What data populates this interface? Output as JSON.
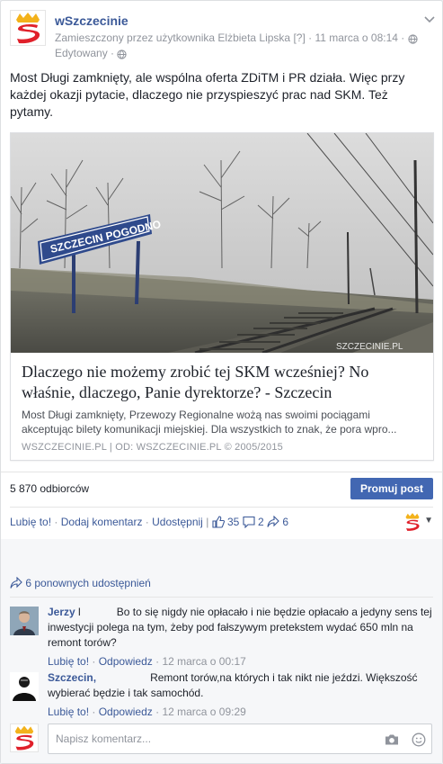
{
  "header": {
    "page_name": "wSzczecinie",
    "meta_text": "Zamieszczony przez użytkownika Elżbieta Lipska [?] · 11 marca o 08:14 · ",
    "edited": "Edytowany · "
  },
  "post": {
    "text": "Most Długi zamknięty, ale wspólna oferta ZDiTM i PR działa. Więc przy każdej okazji pytacie, dlaczego nie przyspieszyć prac nad SKM. Też pytamy."
  },
  "attachment": {
    "image_sign_text": "SZCZECIN POGODNO",
    "image_watermark": "SZCZECINIE.PL",
    "title": "Dlaczego nie możemy zrobić tej SKM wcześniej? No właśnie, dlaczego, Panie dyrektorze? - Szczecin",
    "description": "Most Długi zamknięty, Przewozy Regionalne wożą nas swoimi pociągami akceptując bilety komunikacji miejskiej. Dla wszystkich to znak, że pora wpro...",
    "source": "WSZCZECINIE.PL   |   OD: WSZCZECINIE.PL © 2005/2015"
  },
  "stats": {
    "followers": "5 870 odbiorców",
    "promote_label": "Promuj post"
  },
  "actions": {
    "like": "Lubię to!",
    "comment": "Dodaj komentarz",
    "share": "Udostępnij",
    "likes_count": "35",
    "comments_count": "2",
    "shares_count": "6"
  },
  "shares_line": "6 ponownych udostępnień",
  "comments": [
    {
      "author": "Jerzy",
      "after_author": " l           ",
      "text": "Bo to się nigdy nie opłacało i nie będzie opłacało a jedyny sens tej inwestycji polega na tym, żeby pod fałszywym pretekstem wydać 650 mln na remont torów?",
      "like": "Lubię to!",
      "reply": "Odpowiedz",
      "time": "12 marca o 00:17"
    },
    {
      "author": "Szczecin,",
      "after_author": "                 ",
      "text": "Remont torów,na których i tak nikt nie jeździ. Większość wybierać będzie i tak samochód.",
      "like": "Lubię to!",
      "reply": "Odpowiedz",
      "time": "12 marca o 09:29"
    }
  ],
  "comment_input": {
    "placeholder": "Napisz komentarz..."
  },
  "colors": {
    "brand": "#3b5998",
    "button": "#4267b2",
    "logo_red": "#e0202a",
    "logo_gold": "#f3b21b"
  },
  "icons": [
    "crown-logo-icon",
    "chevron-down-icon",
    "globe-icon",
    "thumbs-up-icon",
    "comment-bubble-icon",
    "share-arrow-icon",
    "camera-icon",
    "smiley-icon"
  ]
}
